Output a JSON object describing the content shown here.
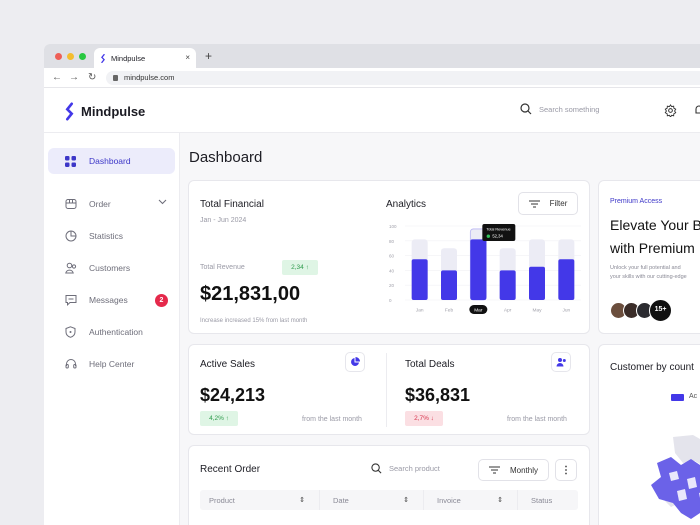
{
  "browser": {
    "tab_title": "Mindpulse",
    "tab_close": "×",
    "new_tab": "+",
    "url": "mindpulse.com",
    "nav_back": "←",
    "nav_forward": "→",
    "nav_reload": "↻"
  },
  "app": {
    "brand": "Mindpulse",
    "search_placeholder": "Search something",
    "accent": "#4338ff"
  },
  "sidebar": {
    "items": [
      {
        "label": "Dashboard",
        "icon": "grid-icon",
        "active": true
      },
      {
        "label": "Order",
        "icon": "store-icon"
      },
      {
        "label": "Statistics",
        "icon": "pie-chart-icon"
      },
      {
        "label": "Customers",
        "icon": "users-icon"
      },
      {
        "label": "Messages",
        "icon": "message-icon",
        "badge": "2"
      },
      {
        "label": "Authentication",
        "icon": "shield-icon"
      },
      {
        "label": "Help Center",
        "icon": "headset-icon"
      }
    ]
  },
  "main": {
    "title": "Dashboard",
    "financial": {
      "title": "Total Financial",
      "period": "Jan - Jun 2024",
      "revenue_label": "Total Revenue",
      "change": "2,34 ↑",
      "value": "$21,831,00",
      "note": "Increase increased 15% from last month"
    },
    "analytics": {
      "title": "Analytics",
      "filter_label": "Filter",
      "tooltip_title": "Total Revenue",
      "tooltip_value": "52,34"
    },
    "active_sales": {
      "title": "Active Sales",
      "value": "$24,213",
      "change": "4,2% ↑",
      "note": "from the last month"
    },
    "total_deals": {
      "title": "Total Deals",
      "value": "$36,831",
      "change": "2,7% ↓",
      "note": "from the last month"
    },
    "recent_order": {
      "title": "Recent Order",
      "search_placeholder": "Search product",
      "period": "Monthly",
      "more": "⋮",
      "columns": [
        "Product",
        "Date",
        "Invoice",
        "Status"
      ]
    },
    "premium": {
      "eyebrow": "Premium Access",
      "heading_line1": "Elevate Your B",
      "heading_line2": "with Premium",
      "desc_line1": "Unlock your full potential and ",
      "desc_line2": "your skills with our cutting-edge",
      "count": "15+"
    },
    "country": {
      "title": "Customer by count",
      "legend": "Ac"
    }
  },
  "chart_data": {
    "type": "bar",
    "categories": [
      "Jan",
      "Feb",
      "Mar",
      "Apr",
      "May",
      "Jun"
    ],
    "values": [
      55,
      40,
      82,
      40,
      45,
      55
    ],
    "background_values": [
      82,
      70,
      96,
      70,
      82,
      82
    ],
    "highlight": "Mar",
    "ylim": [
      0,
      100
    ],
    "yticks": [
      "100",
      "80",
      "60",
      "40",
      "20",
      "0"
    ],
    "bar_color": "#4338e8",
    "track_color": "#ececf5"
  }
}
